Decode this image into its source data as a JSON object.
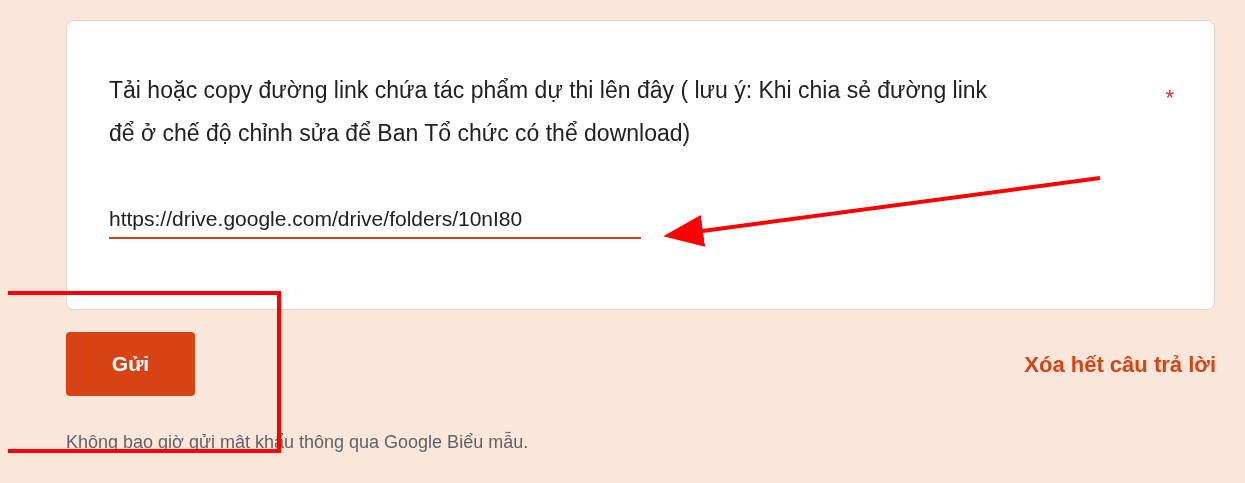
{
  "question": {
    "title": "Tải hoặc copy đường link chứa tác phẩm dự thi lên đây ( lưu ý: Khi chia sẻ đường link để ở chế độ chỉnh sửa để Ban Tổ chức có thể download)",
    "required_mark": "*",
    "answer": "https://drive.google.com/drive/folders/10nI80",
    "focused": true
  },
  "submit_button": "Gửi",
  "clear_link": "Xóa hết câu trả lời",
  "footer": "Không bao giờ gửi mật khẩu thông qua Google Biểu mẫu."
}
